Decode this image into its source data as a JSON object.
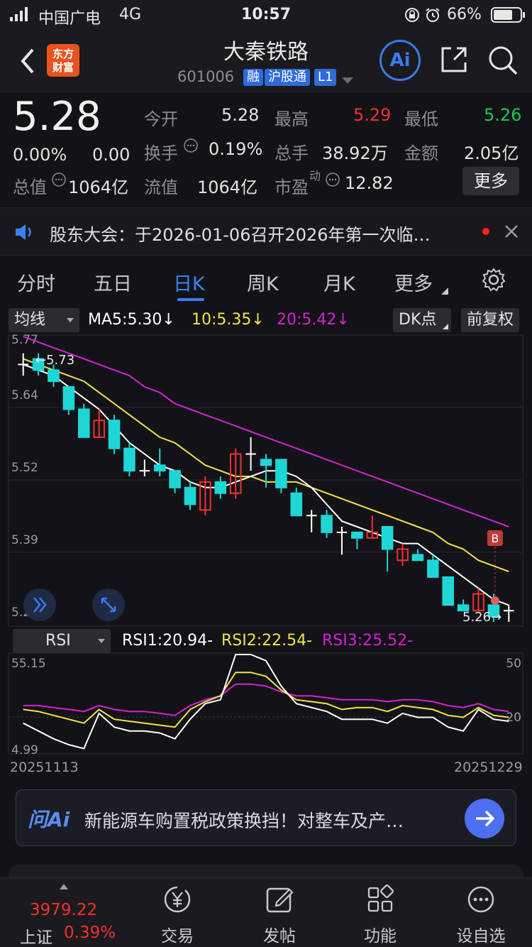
{
  "status_bar": {
    "carrier": "中国广电",
    "network": "4G",
    "time": "10:57",
    "battery": "66%"
  },
  "header": {
    "logo_line1": "东方",
    "logo_line2": "财富",
    "title": "大秦铁路",
    "code": "601006",
    "tags": [
      "融",
      "沪股通",
      "L1"
    ],
    "ai_label": "Ai"
  },
  "quote": {
    "price": "5.28",
    "change_pct": "0.00%",
    "change": "0.00",
    "open_label": "今开",
    "open": "5.28",
    "high_label": "最高",
    "high": "5.29",
    "low_label": "最低",
    "low": "5.26",
    "turnover_label": "换手",
    "turnover": "0.19%",
    "volume_label": "总手",
    "volume": "38.92万",
    "amount_label": "金额",
    "amount": "2.05亿",
    "mcap_label": "总值",
    "mcap": "1064亿",
    "float_label": "流值",
    "float_cap": "1064亿",
    "pe_label": "市盈",
    "pe_sup": "动",
    "pe": "12.82",
    "more_label": "更多"
  },
  "notice": {
    "text": "股东大会：于2026-01-06召开2026年第一次临…"
  },
  "tabs": [
    "分时",
    "五日",
    "日K",
    "周K",
    "月K",
    "更多"
  ],
  "active_tab": "日K",
  "chart_toolbar": {
    "indicator": "均线",
    "ma5": "MA5:5.30",
    "ma10": "10:5.35",
    "ma20": "20:5.42",
    "dk": "DK点",
    "adjust": "前复权",
    "arrow": "↓"
  },
  "colors": {
    "up": "#f23030",
    "down": "#1fd6d6",
    "ma5": "#ffffff",
    "ma10": "#f2e24a",
    "ma20": "#d520d5",
    "accent": "#2f6ad8"
  },
  "chart_data": [
    {
      "type": "candlestick",
      "ylim": [
        5.26,
        5.77
      ],
      "y_ticks": [
        "5.77",
        "5.64",
        "5.52",
        "5.39",
        "5.26"
      ],
      "high_marker": "←5.73",
      "low_marker": "5.26→",
      "b_marker": "B",
      "candles": [
        {
          "o": 5.72,
          "c": 5.72,
          "h": 5.74,
          "l": 5.7
        },
        {
          "o": 5.73,
          "c": 5.71,
          "h": 5.74,
          "l": 5.7
        },
        {
          "o": 5.71,
          "c": 5.69,
          "h": 5.72,
          "l": 5.68
        },
        {
          "o": 5.68,
          "c": 5.64,
          "h": 5.68,
          "l": 5.63
        },
        {
          "o": 5.64,
          "c": 5.59,
          "h": 5.65,
          "l": 5.59
        },
        {
          "o": 5.59,
          "c": 5.62,
          "h": 5.64,
          "l": 5.59
        },
        {
          "o": 5.62,
          "c": 5.57,
          "h": 5.63,
          "l": 5.56
        },
        {
          "o": 5.57,
          "c": 5.53,
          "h": 5.58,
          "l": 5.52
        },
        {
          "o": 5.53,
          "c": 5.53,
          "h": 5.55,
          "l": 5.52
        },
        {
          "o": 5.54,
          "c": 5.53,
          "h": 5.57,
          "l": 5.52
        },
        {
          "o": 5.53,
          "c": 5.5,
          "h": 5.53,
          "l": 5.49
        },
        {
          "o": 5.5,
          "c": 5.47,
          "h": 5.51,
          "l": 5.46
        },
        {
          "o": 5.46,
          "c": 5.51,
          "h": 5.52,
          "l": 5.45
        },
        {
          "o": 5.51,
          "c": 5.49,
          "h": 5.52,
          "l": 5.48
        },
        {
          "o": 5.49,
          "c": 5.56,
          "h": 5.57,
          "l": 5.48
        },
        {
          "o": 5.56,
          "c": 5.56,
          "h": 5.59,
          "l": 5.53
        },
        {
          "o": 5.55,
          "c": 5.54,
          "h": 5.56,
          "l": 5.5
        },
        {
          "o": 5.55,
          "c": 5.5,
          "h": 5.55,
          "l": 5.49
        },
        {
          "o": 5.49,
          "c": 5.45,
          "h": 5.5,
          "l": 5.45
        },
        {
          "o": 5.45,
          "c": 5.45,
          "h": 5.46,
          "l": 5.42
        },
        {
          "o": 5.45,
          "c": 5.42,
          "h": 5.46,
          "l": 5.41
        },
        {
          "o": 5.42,
          "c": 5.42,
          "h": 5.43,
          "l": 5.38
        },
        {
          "o": 5.42,
          "c": 5.41,
          "h": 5.42,
          "l": 5.39
        },
        {
          "o": 5.41,
          "c": 5.42,
          "h": 5.45,
          "l": 5.41
        },
        {
          "o": 5.43,
          "c": 5.39,
          "h": 5.43,
          "l": 5.35
        },
        {
          "o": 5.37,
          "c": 5.39,
          "h": 5.4,
          "l": 5.36
        },
        {
          "o": 5.38,
          "c": 5.37,
          "h": 5.39,
          "l": 5.37
        },
        {
          "o": 5.37,
          "c": 5.34,
          "h": 5.38,
          "l": 5.34
        },
        {
          "o": 5.34,
          "c": 5.29,
          "h": 5.34,
          "l": 5.29
        },
        {
          "o": 5.29,
          "c": 5.28,
          "h": 5.3,
          "l": 5.28
        },
        {
          "o": 5.28,
          "c": 5.31,
          "h": 5.32,
          "l": 5.28
        },
        {
          "o": 5.29,
          "c": 5.27,
          "h": 5.31,
          "l": 5.26
        },
        {
          "o": 5.28,
          "c": 5.28,
          "h": 5.29,
          "l": 5.26
        }
      ],
      "ma5": [
        5.72,
        5.71,
        5.7,
        5.68,
        5.66,
        5.64,
        5.61,
        5.58,
        5.56,
        5.54,
        5.53,
        5.51,
        5.5,
        5.5,
        5.51,
        5.52,
        5.53,
        5.53,
        5.52,
        5.5,
        5.47,
        5.44,
        5.43,
        5.42,
        5.41,
        5.4,
        5.4,
        5.38,
        5.36,
        5.34,
        5.32,
        5.3,
        5.29
      ],
      "ma10": [
        5.73,
        5.72,
        5.71,
        5.7,
        5.69,
        5.67,
        5.65,
        5.63,
        5.61,
        5.59,
        5.58,
        5.56,
        5.54,
        5.53,
        5.52,
        5.52,
        5.51,
        5.51,
        5.51,
        5.5,
        5.49,
        5.48,
        5.47,
        5.46,
        5.45,
        5.44,
        5.43,
        5.42,
        5.4,
        5.39,
        5.37,
        5.36,
        5.35
      ],
      "ma20": [
        5.77,
        5.76,
        5.75,
        5.74,
        5.73,
        5.72,
        5.71,
        5.7,
        5.68,
        5.67,
        5.65,
        5.64,
        5.63,
        5.62,
        5.61,
        5.6,
        5.59,
        5.58,
        5.57,
        5.56,
        5.55,
        5.54,
        5.53,
        5.52,
        5.51,
        5.5,
        5.49,
        5.48,
        5.47,
        5.46,
        5.45,
        5.44,
        5.43
      ]
    },
    {
      "type": "line",
      "indicator": "RSI",
      "labels": {
        "rsi1": "RSI1:20.94-",
        "rsi2": "RSI2:22.54-",
        "rsi3": "RSI3:25.52-"
      },
      "left_ticks": [
        "55.15",
        "4.99"
      ],
      "right_ticks": [
        "50",
        "20"
      ],
      "x_start": "20251113",
      "x_end": "20251229",
      "ylim": [
        4.99,
        55.15
      ],
      "rsi1": [
        20,
        16,
        12,
        9,
        7,
        25,
        18,
        16,
        16,
        15,
        12,
        22,
        30,
        32,
        58,
        57,
        52,
        39,
        30,
        28,
        26,
        22,
        22,
        22,
        20,
        25,
        23,
        23,
        18,
        16,
        27,
        22,
        21
      ],
      "rsi2": [
        27,
        26,
        24,
        22,
        20,
        27,
        22,
        21,
        20,
        19,
        18,
        27,
        31,
        34,
        46,
        46,
        44,
        37,
        32,
        31,
        30,
        27,
        28,
        28,
        26,
        29,
        28,
        27,
        24,
        23,
        28,
        24,
        23
      ],
      "rsi3": [
        29,
        29,
        28,
        27,
        26,
        29,
        27,
        26,
        26,
        25,
        24,
        29,
        32,
        34,
        40,
        40,
        39,
        36,
        34,
        34,
        33,
        32,
        32,
        32,
        31,
        32,
        32,
        31,
        29,
        28,
        30,
        27,
        26
      ]
    }
  ],
  "ai_bar": {
    "logo": "问Ai",
    "text": "新能源车购置税政策换挡！对整车及产…"
  },
  "bottom_nav": {
    "index_value": "3979.22",
    "index_name": "上证",
    "index_change": "0.39%",
    "items": [
      "交易",
      "发帖",
      "功能",
      "设自选"
    ]
  }
}
